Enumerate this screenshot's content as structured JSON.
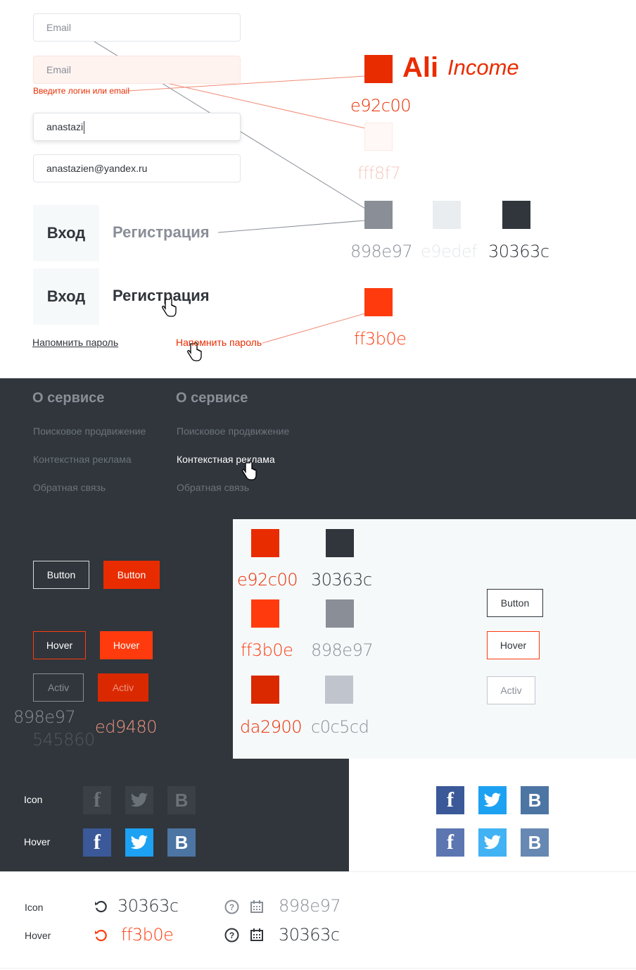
{
  "inputs": {
    "email_placeholder": "Email",
    "email_error_placeholder": "Email",
    "error_message": "Введите логин или email",
    "typing_value": "anastazi",
    "filled_value": "anastazien@yandex.ru"
  },
  "brand": {
    "logo_ali": "Ali",
    "logo_income": "Income"
  },
  "palette_top": {
    "brand_hex": "e92c00",
    "error_bg_hex": "fff8f7",
    "grey_hex": "898e97",
    "light_grey_hex": "e9edef",
    "dark_hex": "30363c",
    "hover_hex": "ff3b0e"
  },
  "tabs": {
    "login": "Вход",
    "register": "Регистрация",
    "login_active": "Вход",
    "register_hover": "Регистрация"
  },
  "links": {
    "remind": "Напомнить пароль",
    "remind_hover": "Напомнить пароль"
  },
  "footer_menu": {
    "title": "О сервисе",
    "title_hover": "О сервисе",
    "items": [
      "Поисковое продвижение",
      "Контекстная реклама",
      "Обратная связь"
    ],
    "items_hover": [
      "Поисковое продвижение",
      "Контекстная реклама",
      "Обратная связь"
    ]
  },
  "buttons": {
    "button": "Button",
    "hover": "Hover",
    "activ": "Activ",
    "outline_activ_border_hex": "898e97",
    "outline_activ_text_hex": "545860",
    "filled_activ_text_hex": "ed9480"
  },
  "palette_buttons": {
    "brand": "e92c00",
    "dark": "30363c",
    "hover": "ff3b0e",
    "grey": "898e97",
    "active": "da2900",
    "light": "c0c5cd"
  },
  "social": {
    "icon_label": "Icon",
    "hover_label": "Hover",
    "facebook": "f",
    "vk": "B"
  },
  "icons_row": {
    "icon_label": "Icon",
    "hover_label": "Hover",
    "dark_hex": "30363c",
    "hover_hex": "ff3b0e",
    "grey_hex": "898e97",
    "dark_hex_2": "30363c"
  },
  "colors": {
    "brand": "#e92c00",
    "hover": "#ff3b0e",
    "active": "#da2900",
    "dark": "#30363c",
    "grey": "#898e97",
    "light_grey": "#e9edef",
    "error_bg": "#fff8f7",
    "facebook": "#3b5998",
    "twitter": "#1da1f2",
    "vk": "#4c75a3"
  }
}
